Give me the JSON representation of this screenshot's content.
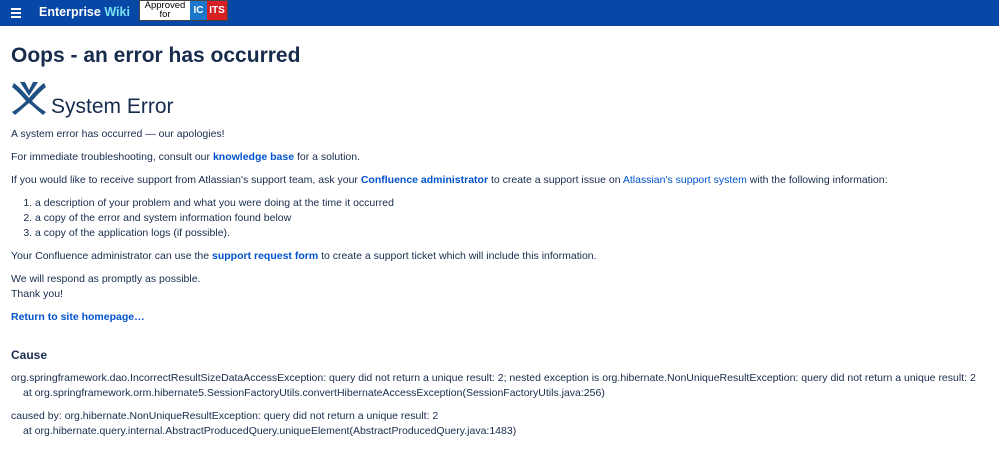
{
  "header": {
    "brand_main": "Enterprise",
    "brand_accent": "Wiki",
    "badge_approved_line1": "Approved",
    "badge_approved_line2": "for",
    "badge_ic": "IC",
    "badge_its": "ITS",
    "menu_icon": "hamburger-menu-icon"
  },
  "page": {
    "title": "Oops - an error has occurred",
    "error_heading": "System Error",
    "logo_icon": "atlassian-confluence-logo",
    "intro": "A system error has occurred — our apologies!",
    "troubleshoot_prefix": "For immediate troubleshooting, consult our ",
    "knowledge_base_link": "knowledge base",
    "troubleshoot_suffix": " for a solution.",
    "support_prefix": "If you would like to receive support from Atlassian's support team, ask your ",
    "confluence_admin_link": "Confluence administrator",
    "support_middle": " to create a support issue on ",
    "support_system_link": "Atlassian's support system",
    "support_suffix": " with the following information:",
    "list_items": [
      "a description of your problem and what you were doing at the time it occurred",
      "a copy of the error and system information found below",
      "a copy of the application logs (if possible)."
    ],
    "admin_prefix": "Your Confluence administrator can use the ",
    "support_form_link": "support request form",
    "admin_suffix": " to create a support ticket which will include this information.",
    "respond_line": "We will respond as promptly as possible.",
    "thanks_line": "Thank you!",
    "return_link": "Return to site homepage…"
  },
  "cause": {
    "heading": "Cause",
    "exception_line": "org.springframework.dao.IncorrectResultSizeDataAccessException: query did not return a unique result: 2; nested exception is org.hibernate.NonUniqueResultException: query did not return a unique result: 2",
    "exception_at": "at org.springframework.orm.hibernate5.SessionFactoryUtils.convertHibernateAccessException(SessionFactoryUtils.java:256)",
    "caused_by_line": "caused by: org.hibernate.NonUniqueResultException: query did not return a unique result: 2",
    "caused_by_at": "at org.hibernate.query.internal.AbstractProducedQuery.uniqueElement(AbstractProducedQuery.java:1483)"
  },
  "colors": {
    "header_bg": "#0747a6",
    "link": "#0052cc",
    "text": "#172b4d",
    "wiki_accent": "#79e2f2"
  }
}
